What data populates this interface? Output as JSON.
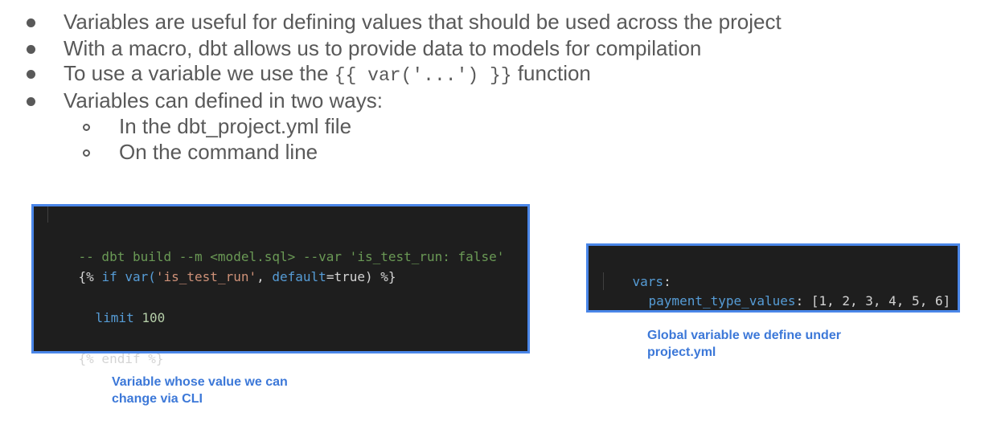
{
  "bullets": [
    {
      "text": "Variables are useful for defining values that should be used across the project"
    },
    {
      "text": "With a macro, dbt allows us to provide data to models for compilation"
    },
    {
      "pre": "To use a variable we use the ",
      "code": "{{ var('...') }}",
      "post": " function"
    },
    {
      "text": "Variables can defined in two ways:"
    }
  ],
  "sub_bullets": [
    {
      "text": "In the dbt_project.yml file"
    },
    {
      "text": "On the command line"
    }
  ],
  "left_code": {
    "comment": "-- dbt build --m <model.sql> --var 'is_test_run: false'",
    "line2": {
      "open": "{% ",
      "kw_if": "if",
      "var_fn": " var(",
      "str": "'is_test_run'",
      "comma": ", ",
      "param": "default",
      "eq_true": "=true) %}"
    },
    "line3": {
      "kw": "limit",
      "num": " 100"
    },
    "line4": "{% endif %}"
  },
  "right_code": {
    "key": "vars",
    "colon": ":",
    "sub_key": "payment_type_values",
    "sub_colon": ": ",
    "value": "[1, 2, 3, 4, 5, 6]"
  },
  "captions": {
    "left": [
      "Variable whose value we can",
      "change via CLI"
    ],
    "right": [
      "Global variable we define under",
      "project.yml"
    ]
  },
  "colors": {
    "accent_border": "#4a86e8",
    "caption": "#3c78d8",
    "editor_bg": "#1e1e1e"
  }
}
